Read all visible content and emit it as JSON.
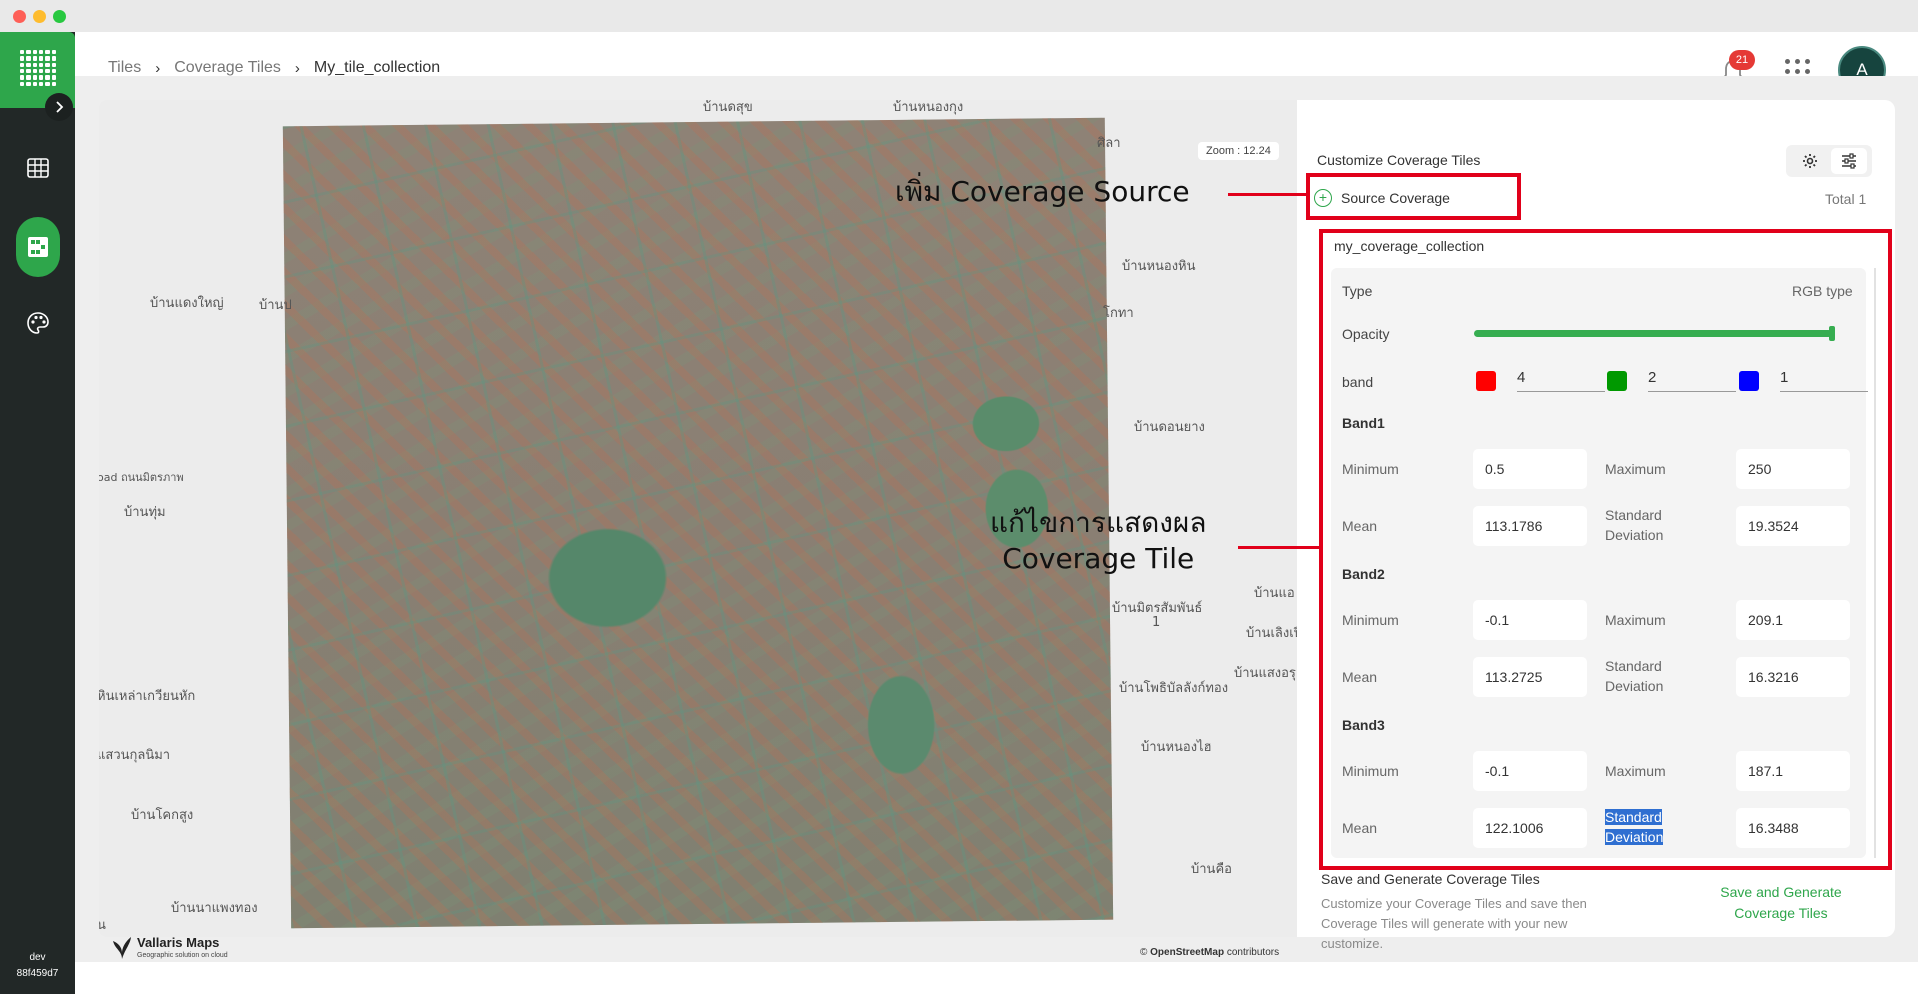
{
  "breadcrumb": {
    "item1": "Tiles",
    "item2": "Coverage Tiles",
    "item3": "My_tile_collection"
  },
  "notifications": {
    "count": "21"
  },
  "user": {
    "initial": "A"
  },
  "sidebar": {
    "env": "dev",
    "build": "88f459d7"
  },
  "map": {
    "zoom_label": "Zoom : 12.24",
    "place_labels": [
      "บ้านดสุข",
      "บ้านหนองกุง",
      "ศิลา",
      "บ้านหนองหิน",
      "บ้านแดงใหญ่",
      "บ้านป",
      "โกทา",
      "บ้านดอนยาง",
      "oad ถนนมิตรภาพ",
      "บ้านทุ่ม",
      "บ้านมิตรสัมพันธ์",
      "1",
      "บ้านแอ",
      "บ้านเลิงเปื",
      "บ้านแสงอรุ",
      "บ้านโพธิบัลลังก์ทอง",
      "บ้านหนองไฮ",
      "หินเหล่าเกวียนหัก",
      "แสวนกุลนิมา",
      "บ้านโคกสูง",
      "บ้านนาแพงทอง",
      "บ้านคือ",
      "น"
    ],
    "brand_name": "Vallaris Maps",
    "brand_tagline": "Geographic solution on cloud",
    "attribution_prefix": "©",
    "attribution_osm": "OpenStreetMap",
    "attribution_suffix": "contributors"
  },
  "panel": {
    "title": "Customize Coverage Tiles",
    "source_label": "Source Coverage",
    "total": "Total 1",
    "collection_name": "my_coverage_collection",
    "type_label": "Type",
    "type_value": "RGB type",
    "opacity_label": "Opacity",
    "opacity_value": 1.0,
    "band_label": "band",
    "band_values": {
      "red": "4",
      "green": "2",
      "blue": "1"
    },
    "bands": [
      {
        "name": "Band1",
        "min_label": "Minimum",
        "min": "0.5",
        "max_label": "Maximum",
        "max": "250",
        "mean_label": "Mean",
        "mean": "113.1786",
        "sd_label_1": "Standard",
        "sd_label_2": "Deviation",
        "sd": "19.3524"
      },
      {
        "name": "Band2",
        "min_label": "Minimum",
        "min": "-0.1",
        "max_label": "Maximum",
        "max": "209.1",
        "mean_label": "Mean",
        "mean": "113.2725",
        "sd_label_1": "Standard",
        "sd_label_2": "Deviation",
        "sd": "16.3216"
      },
      {
        "name": "Band3",
        "min_label": "Minimum",
        "min": "-0.1",
        "max_label": "Maximum",
        "max": "187.1",
        "mean_label": "Mean",
        "mean": "122.1006",
        "sd_label_1": "Standard",
        "sd_label_2": "Deviation",
        "sd": "16.3488"
      }
    ],
    "save_title": "Save and Generate Coverage Tiles",
    "save_desc": "Customize your Coverage Tiles and save then Coverage Tiles will generate with your new customize.",
    "save_button_line1": "Save and Generate",
    "save_button_line2": "Coverage Tiles"
  },
  "annotations": {
    "add_source": "เพิ่ม Coverage Source",
    "edit_display_1": "แก้ไขการแสดงผล",
    "edit_display_2": "Coverage Tile"
  },
  "colors": {
    "brand_green": "#2ea64b",
    "annotation_red": "#e1001a",
    "band_red": "#ff0000",
    "band_green": "#009900",
    "band_blue": "#0000ff",
    "sidebar_dark": "#222827"
  }
}
